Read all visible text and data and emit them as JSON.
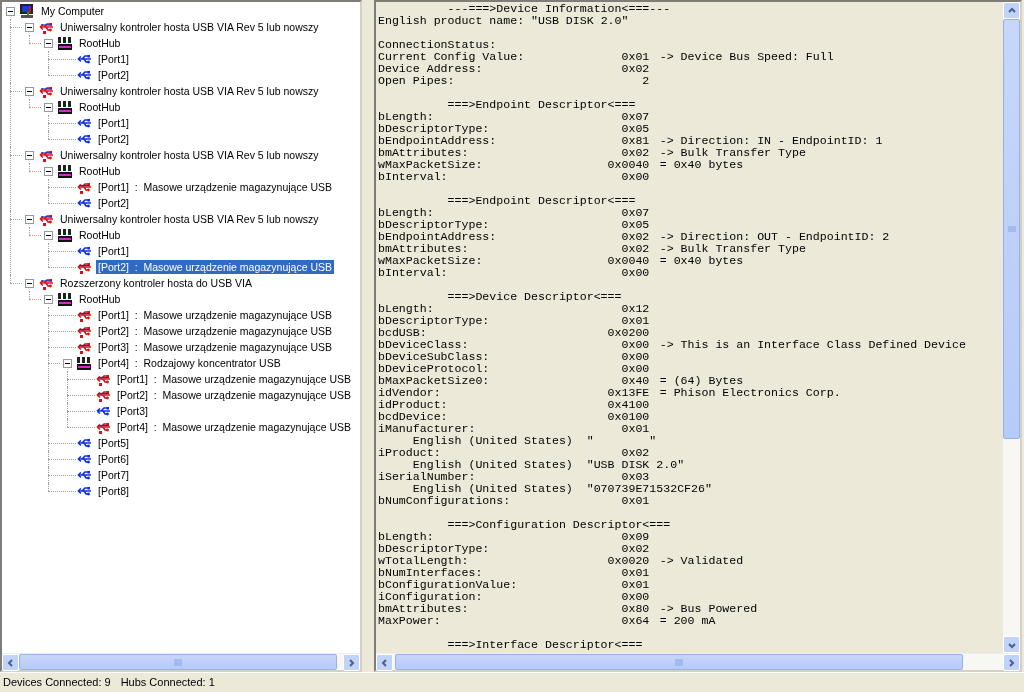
{
  "tree": {
    "items": [
      {
        "kind": "computer",
        "label": "My Computer",
        "expanded": true,
        "selected": false,
        "children": [
          {
            "kind": "controller",
            "label": "Uniwersalny kontroler hosta USB VIA Rev 5 lub nowszy",
            "expanded": true,
            "selected": false,
            "children": [
              {
                "kind": "hub",
                "label": "RootHub",
                "expanded": true,
                "selected": false,
                "children": [
                  {
                    "kind": "port",
                    "label": "[Port1]",
                    "selected": false
                  },
                  {
                    "kind": "port",
                    "label": "[Port2]",
                    "selected": false
                  }
                ]
              }
            ]
          },
          {
            "kind": "controller",
            "label": "Uniwersalny kontroler hosta USB VIA Rev 5 lub nowszy",
            "expanded": true,
            "selected": false,
            "children": [
              {
                "kind": "hub",
                "label": "RootHub",
                "expanded": true,
                "selected": false,
                "children": [
                  {
                    "kind": "port",
                    "label": "[Port1]",
                    "selected": false
                  },
                  {
                    "kind": "port",
                    "label": "[Port2]",
                    "selected": false
                  }
                ]
              }
            ]
          },
          {
            "kind": "controller",
            "label": "Uniwersalny kontroler hosta USB VIA Rev 5 lub nowszy",
            "expanded": true,
            "selected": false,
            "children": [
              {
                "kind": "hub",
                "label": "RootHub",
                "expanded": true,
                "selected": false,
                "children": [
                  {
                    "kind": "device",
                    "label": "[Port1]  :  Masowe urządzenie magazynujące USB",
                    "selected": false
                  },
                  {
                    "kind": "port",
                    "label": "[Port2]",
                    "selected": false
                  }
                ]
              }
            ]
          },
          {
            "kind": "controller",
            "label": "Uniwersalny kontroler hosta USB VIA Rev 5 lub nowszy",
            "expanded": true,
            "selected": false,
            "children": [
              {
                "kind": "hub",
                "label": "RootHub",
                "expanded": true,
                "selected": false,
                "children": [
                  {
                    "kind": "port",
                    "label": "[Port1]",
                    "selected": false
                  },
                  {
                    "kind": "device",
                    "label": "[Port2]  :  Masowe urządzenie magazynujące USB",
                    "selected": true
                  }
                ]
              }
            ]
          },
          {
            "kind": "controller",
            "label": "Rozszerzony kontroler hosta do USB VIA",
            "expanded": true,
            "selected": false,
            "children": [
              {
                "kind": "hub",
                "label": "RootHub",
                "expanded": true,
                "selected": false,
                "children": [
                  {
                    "kind": "device",
                    "label": "[Port1]  :  Masowe urządzenie magazynujące USB",
                    "selected": false
                  },
                  {
                    "kind": "device",
                    "label": "[Port2]  :  Masowe urządzenie magazynujące USB",
                    "selected": false
                  },
                  {
                    "kind": "device",
                    "label": "[Port3]  :  Masowe urządzenie magazynujące USB",
                    "selected": false
                  },
                  {
                    "kind": "hub",
                    "label": "[Port4]  :  Rodzajowy koncentrator USB",
                    "expanded": true,
                    "selected": false,
                    "children": [
                      {
                        "kind": "device",
                        "label": "[Port1]  :  Masowe urządzenie magazynujące USB",
                        "selected": false
                      },
                      {
                        "kind": "device",
                        "label": "[Port2]  :  Masowe urządzenie magazynujące USB",
                        "selected": false
                      },
                      {
                        "kind": "port",
                        "label": "[Port3]",
                        "selected": false
                      },
                      {
                        "kind": "device",
                        "label": "[Port4]  :  Masowe urządzenie magazynujące USB",
                        "selected": false
                      }
                    ]
                  },
                  {
                    "kind": "port",
                    "label": "[Port5]",
                    "selected": false
                  },
                  {
                    "kind": "port",
                    "label": "[Port6]",
                    "selected": false
                  },
                  {
                    "kind": "port",
                    "label": "[Port7]",
                    "selected": false
                  },
                  {
                    "kind": "port",
                    "label": "[Port8]",
                    "selected": false
                  }
                ]
              }
            ]
          }
        ]
      }
    ]
  },
  "details": {
    "lines": [
      {
        "kind": "header",
        "text": "---===>Device Information<===---"
      },
      {
        "kind": "text",
        "text": "English product name: \"USB DISK 2.0\""
      },
      {
        "kind": "blank"
      },
      {
        "kind": "text",
        "text": "ConnectionStatus:"
      },
      {
        "kind": "field",
        "label": "Current Config Value:",
        "value": "0x01",
        "note": "-> Device Bus Speed: Full"
      },
      {
        "kind": "field",
        "label": "Device Address:",
        "value": "0x02"
      },
      {
        "kind": "field",
        "label": "Open Pipes:",
        "value": "2"
      },
      {
        "kind": "blank"
      },
      {
        "kind": "header",
        "text": "===>Endpoint Descriptor<==="
      },
      {
        "kind": "field",
        "label": "bLength:",
        "value": "0x07"
      },
      {
        "kind": "field",
        "label": "bDescriptorType:",
        "value": "0x05"
      },
      {
        "kind": "field",
        "label": "bEndpointAddress:",
        "value": "0x81",
        "note": "-> Direction: IN - EndpointID: 1"
      },
      {
        "kind": "field",
        "label": "bmAttributes:",
        "value": "0x02",
        "note": "-> Bulk Transfer Type"
      },
      {
        "kind": "field",
        "label": "wMaxPacketSize:",
        "value": "0x0040",
        "note": "= 0x40 bytes"
      },
      {
        "kind": "field",
        "label": "bInterval:",
        "value": "0x00"
      },
      {
        "kind": "blank"
      },
      {
        "kind": "header",
        "text": "===>Endpoint Descriptor<==="
      },
      {
        "kind": "field",
        "label": "bLength:",
        "value": "0x07"
      },
      {
        "kind": "field",
        "label": "bDescriptorType:",
        "value": "0x05"
      },
      {
        "kind": "field",
        "label": "bEndpointAddress:",
        "value": "0x02",
        "note": "-> Direction: OUT - EndpointID: 2"
      },
      {
        "kind": "field",
        "label": "bmAttributes:",
        "value": "0x02",
        "note": "-> Bulk Transfer Type"
      },
      {
        "kind": "field",
        "label": "wMaxPacketSize:",
        "value": "0x0040",
        "note": "= 0x40 bytes"
      },
      {
        "kind": "field",
        "label": "bInterval:",
        "value": "0x00"
      },
      {
        "kind": "blank"
      },
      {
        "kind": "header",
        "text": "===>Device Descriptor<==="
      },
      {
        "kind": "field",
        "label": "bLength:",
        "value": "0x12"
      },
      {
        "kind": "field",
        "label": "bDescriptorType:",
        "value": "0x01"
      },
      {
        "kind": "field",
        "label": "bcdUSB:",
        "value": "0x0200"
      },
      {
        "kind": "field",
        "label": "bDeviceClass:",
        "value": "0x00",
        "note": "-> This is an Interface Class Defined Device"
      },
      {
        "kind": "field",
        "label": "bDeviceSubClass:",
        "value": "0x00"
      },
      {
        "kind": "field",
        "label": "bDeviceProtocol:",
        "value": "0x00"
      },
      {
        "kind": "field",
        "label": "bMaxPacketSize0:",
        "value": "0x40",
        "note": "= (64) Bytes"
      },
      {
        "kind": "field",
        "label": "idVendor:",
        "value": "0x13FE",
        "note": "= Phison Electronics Corp."
      },
      {
        "kind": "field",
        "label": "idProduct:",
        "value": "0x4100"
      },
      {
        "kind": "field",
        "label": "bcdDevice:",
        "value": "0x0100"
      },
      {
        "kind": "field",
        "label": "iManufacturer:",
        "value": "0x01"
      },
      {
        "kind": "string",
        "label": "English (United States)",
        "value": "\"        \""
      },
      {
        "kind": "field",
        "label": "iProduct:",
        "value": "0x02"
      },
      {
        "kind": "string",
        "label": "English (United States)",
        "value": "\"USB DISK 2.0\""
      },
      {
        "kind": "field",
        "label": "iSerialNumber:",
        "value": "0x03"
      },
      {
        "kind": "string",
        "label": "English (United States)",
        "value": "\"070739E71532CF26\""
      },
      {
        "kind": "field",
        "label": "bNumConfigurations:",
        "value": "0x01"
      },
      {
        "kind": "blank"
      },
      {
        "kind": "header",
        "text": "===>Configuration Descriptor<==="
      },
      {
        "kind": "field",
        "label": "bLength:",
        "value": "0x09"
      },
      {
        "kind": "field",
        "label": "bDescriptorType:",
        "value": "0x02"
      },
      {
        "kind": "field",
        "label": "wTotalLength:",
        "value": "0x0020",
        "note": "-> Validated"
      },
      {
        "kind": "field",
        "label": "bNumInterfaces:",
        "value": "0x01"
      },
      {
        "kind": "field",
        "label": "bConfigurationValue:",
        "value": "0x01"
      },
      {
        "kind": "field",
        "label": "iConfiguration:",
        "value": "0x00"
      },
      {
        "kind": "field",
        "label": "bmAttributes:",
        "value": "0x80",
        "note": "-> Bus Powered"
      },
      {
        "kind": "field",
        "label": "MaxPower:",
        "value": "0x64",
        "note": "= 200 mA"
      },
      {
        "kind": "blank"
      },
      {
        "kind": "header",
        "text": "===>Interface Descriptor<==="
      }
    ]
  },
  "status_bar": {
    "devices": "Devices Connected: 9",
    "hubs": "Hubs Connected: 1"
  }
}
